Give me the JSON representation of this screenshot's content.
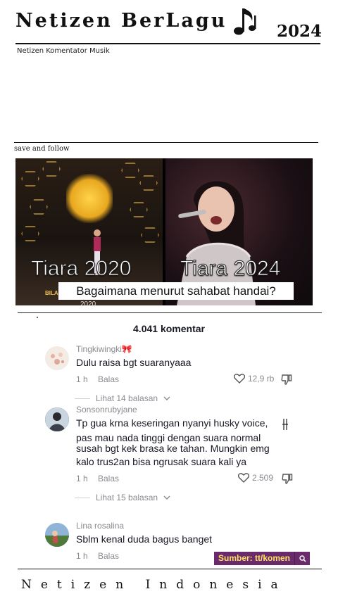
{
  "header": {
    "title": "Netizen BerLagu",
    "year": "2024",
    "subtitle": "Netizen Komentator Musik",
    "note_icon": "music-note-icon"
  },
  "post": {
    "save_follow": "save and follow",
    "left_label": "Tiara 2020",
    "right_label": "Tiara 2024",
    "question": "Bagaimana menurut sahabat handai?",
    "left_caption_fragment": "BILA",
    "year_fragment": "2020"
  },
  "comments_section": {
    "count_label": "4.041 komentar",
    "comments": [
      {
        "username": "Tingkiwingki🎀",
        "lines": [
          "Dulu raisa bgt suaranyaaa"
        ],
        "time": "1 h",
        "reply": "Balas",
        "likes": "12,9 rb",
        "replies_label": "Lihat 14 balasan"
      },
      {
        "username": "Sonsonrubyjane",
        "lines": [
          "Tp gua krna keseringan nyanyi husky voice,",
          "pas mau nada tinggi dengan suara normal",
          "susah bgt kek brasa ke tahan. Mungkin emg",
          "kalo trus2an bisa ngrusak suara kali ya"
        ],
        "time": "1 h",
        "reply": "Balas",
        "likes": "2.509",
        "replies_label": "Lihat 15 balasan"
      },
      {
        "username": "Lina rosalina",
        "lines": [
          "Sblm kenal duda bagus banget"
        ],
        "time": "1 h",
        "reply": "Balas"
      }
    ]
  },
  "source_badge": {
    "label": "Sumber: tt/komen",
    "icon": "search-icon"
  },
  "footer": {
    "text": "Netizen Indonesia"
  },
  "colors": {
    "source_bg": "#6b2a6b",
    "source_text": "#ffe45c",
    "muted": "#8a8b91",
    "stage_gold": "#e8a820"
  }
}
